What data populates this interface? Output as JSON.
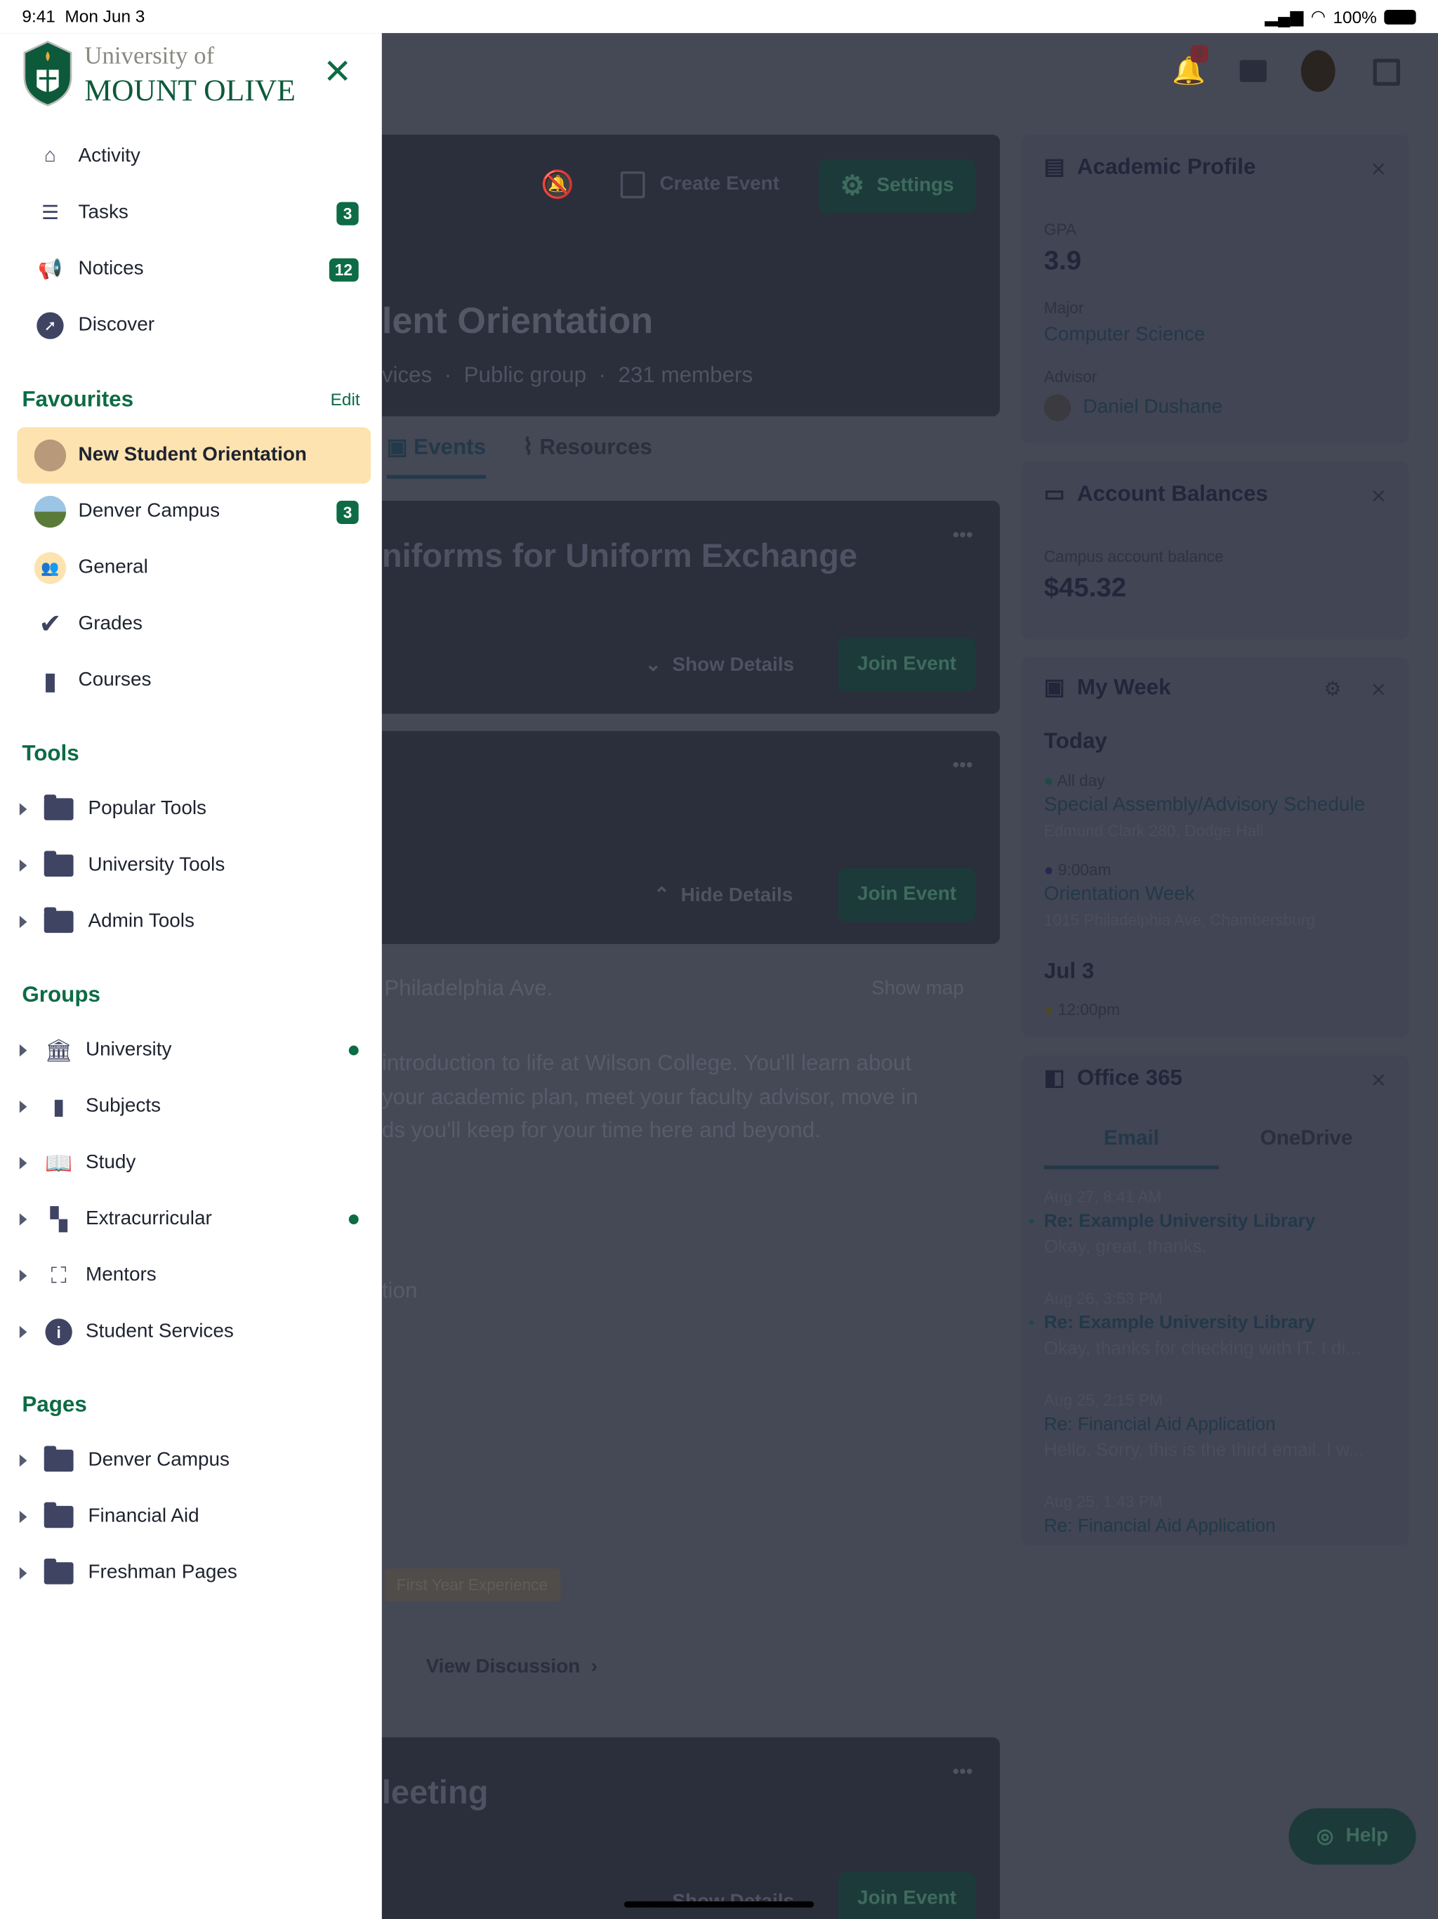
{
  "status_bar": {
    "time": "9:41",
    "date": "Mon Jun 3",
    "battery": "100%"
  },
  "logo": {
    "line1": "University of",
    "line2": "MOUNT OLIVE"
  },
  "nav": [
    {
      "label": "Activity",
      "icon": "home-icon"
    },
    {
      "label": "Tasks",
      "icon": "tasks-icon",
      "badge": "3"
    },
    {
      "label": "Notices",
      "icon": "megaphone-icon",
      "badge": "12"
    },
    {
      "label": "Discover",
      "icon": "compass-icon"
    }
  ],
  "favourites": {
    "title": "Favourites",
    "edit": "Edit",
    "items": [
      {
        "label": "New Student Orientation",
        "selected": true
      },
      {
        "label": "Denver Campus",
        "badge": "3"
      },
      {
        "label": "General"
      },
      {
        "label": "Grades"
      },
      {
        "label": "Courses"
      }
    ]
  },
  "tools": {
    "title": "Tools",
    "items": [
      "Popular Tools",
      "University Tools",
      "Admin Tools"
    ]
  },
  "groups": {
    "title": "Groups",
    "items": [
      {
        "label": "University",
        "dot": true
      },
      {
        "label": "Subjects"
      },
      {
        "label": "Study"
      },
      {
        "label": "Extracurricular",
        "dot": true
      },
      {
        "label": "Mentors"
      },
      {
        "label": "Student Services"
      }
    ]
  },
  "pages": {
    "title": "Pages",
    "items": [
      "Denver Campus",
      "Financial Aid",
      "Freshman Pages"
    ]
  },
  "header": {
    "notif_count": "3"
  },
  "group": {
    "title_partial": "lent Orientation",
    "meta_partial": "vices",
    "type": "Public group",
    "members": "231 members",
    "create_event": "Create Event",
    "settings": "Settings",
    "tabs": [
      "Events",
      "Resources"
    ]
  },
  "events": [
    {
      "title_partial": "niforms for Uniform Exchange",
      "details": "Show Details",
      "join": "Join Event"
    },
    {
      "details": "Hide Details",
      "join": "Join Event"
    },
    {
      "title_partial": "leeting",
      "details": "Show Details",
      "join": "Join Event"
    }
  ],
  "event_detail": {
    "address_partial": "Philadelphia Ave.",
    "show_map": "Show map",
    "desc": [
      "introduction to life at Wilson College. You'll learn about",
      "your academic plan, meet your faculty advisor, move in",
      "ds you'll keep for your time here and beyond."
    ],
    "section_partial": "tion",
    "tag": "First Year Experience",
    "view_discussion": "View Discussion"
  },
  "academic": {
    "title": "Academic Profile",
    "gpa_label": "GPA",
    "gpa": "3.9",
    "major_label": "Major",
    "major": "Computer Science",
    "advisor_label": "Advisor",
    "advisor": "Daniel Dushane"
  },
  "balances": {
    "title": "Account Balances",
    "label": "Campus account balance",
    "value": "$45.32"
  },
  "week": {
    "title": "My Week",
    "today": "Today",
    "items": [
      {
        "time": "All day",
        "title": "Special Assembly/Advisory Schedule",
        "loc": "Edmund Clark 280, Dodge Hall"
      },
      {
        "time": "9:00am",
        "title": "Orientation Week",
        "loc": "1015 Philadelphia Ave, Chambersburg"
      }
    ],
    "jul": "Jul 3",
    "jul_time": "12:00pm"
  },
  "office": {
    "title": "Office 365",
    "tabs": [
      "Email",
      "OneDrive"
    ],
    "emails": [
      {
        "date": "Aug 27, 8:41 AM",
        "subject": "Re: Example University Library",
        "preview": "Okay, great, thanks.",
        "unread": true
      },
      {
        "date": "Aug 26, 3:53 PM",
        "subject": "Re: Example University Library",
        "preview": "Okay, thanks for checking with IT. I di...",
        "unread": true
      },
      {
        "date": "Aug 25, 2:15 PM",
        "subject": "Re: Financial Aid Application",
        "preview": "Hello. Sorry, this is the third email. I w..."
      },
      {
        "date": "Aug 25, 1:43 PM",
        "subject": "Re: Financial Aid Application"
      }
    ]
  },
  "help": "Help",
  "colors": {
    "brand": "#0d6b45",
    "selected": "#fde3b0",
    "overlay": "#454855"
  }
}
